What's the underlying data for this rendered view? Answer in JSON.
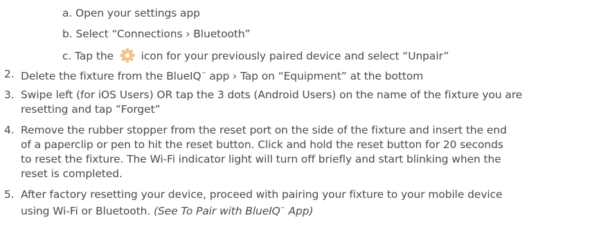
{
  "substeps": {
    "a": "a. Open your settings app",
    "b": "b. Select “Connections › Bluetooth”",
    "c_before": "c. Tap the",
    "c_after": "icon for your previously paired device and select “Unpair”",
    "c_icon": "gear-icon"
  },
  "steps": [
    {
      "number": "2.",
      "lines": [
        {
          "pre": "Delete the fixture from the BlueIQ",
          "tm": "™",
          "post": " app › Tap on “Equipment” at the bottom"
        }
      ]
    },
    {
      "number": "3.",
      "lines": [
        "Swipe left (for iOS Users) OR tap the 3 dots (Android Users) on the name of the fixture you are",
        "resetting and tap ”Forget”"
      ]
    },
    {
      "number": "4.",
      "lines": [
        "Remove the rubber stopper from the reset port on the side of the fixture and insert the end",
        "of a paperclip or pen to hit the reset button. Click and hold the reset button for 20 seconds",
        "to reset the fixture. The Wi-Fi indicator light will turn off briefly and start blinking when the",
        "reset is completed."
      ]
    },
    {
      "number": "5.",
      "lines": [
        "After factory resetting your device, proceed with pairing your fixture to your mobile device",
        {
          "pre": "using Wi-Fi or Bluetooth. ",
          "italic_pre": "(See To Pair with BlueIQ",
          "tm": "™",
          "italic_post": " App)"
        }
      ]
    }
  ],
  "colors": {
    "text": "#4a4a4a",
    "gear_outer": "#f0c28a",
    "gear_inner": "#ffffff"
  }
}
